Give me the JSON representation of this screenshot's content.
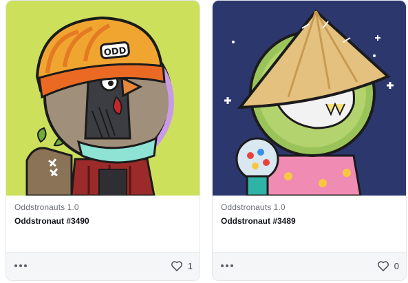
{
  "cards": [
    {
      "collection": "Oddstronauts 1.0",
      "token": "Oddstronaut #3490",
      "likes": "1",
      "beanie_text": "ODD",
      "background": "#cde05c",
      "icons": {
        "more": "more-options-icon",
        "like": "heart-icon"
      }
    },
    {
      "collection": "Oddstronauts 1.0",
      "token": "Oddstronaut #3489",
      "likes": "0",
      "background": "#2c376e",
      "icons": {
        "more": "more-options-icon",
        "like": "heart-icon"
      }
    }
  ]
}
